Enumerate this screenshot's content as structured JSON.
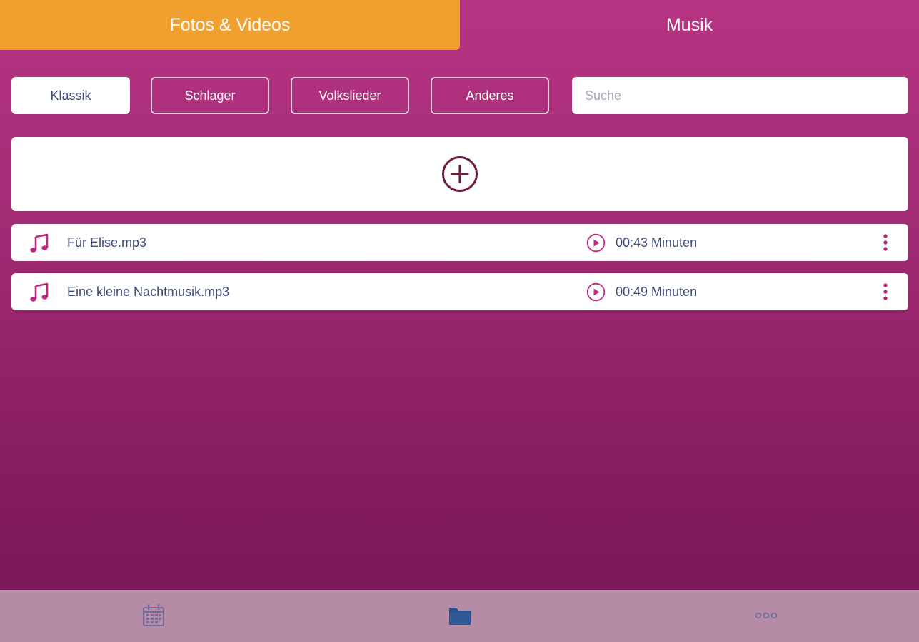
{
  "tabs": {
    "fotos_label": "Fotos & Videos",
    "musik_label": "Musik"
  },
  "filters": {
    "klassik": "Klassik",
    "schlager": "Schlager",
    "volkslieder": "Volkslieder",
    "anderes": "Anderes",
    "search_placeholder": "Suche",
    "search_value": ""
  },
  "files": [
    {
      "name": "Für Elise.mp3",
      "duration": "00:43 Minuten"
    },
    {
      "name": "Eine kleine Nachtmusik.mp3",
      "duration": "00:49 Minuten"
    }
  ],
  "icons": {
    "add": "plus-circle-icon",
    "file": "music-note-icon",
    "play": "play-circle-icon",
    "more": "more-vertical-icon",
    "nav_calendar": "calendar-icon",
    "nav_folder": "folder-icon",
    "nav_more": "more-horizontal-icon"
  },
  "colors": {
    "background_top": "#b63483",
    "background_bottom": "#741654",
    "active_tab": "#f0a02e",
    "accent_pink": "#c2287f",
    "text_dark": "#3f4a78",
    "bottom_nav": "#b68ba6",
    "nav_active": "#2a4f8a"
  }
}
